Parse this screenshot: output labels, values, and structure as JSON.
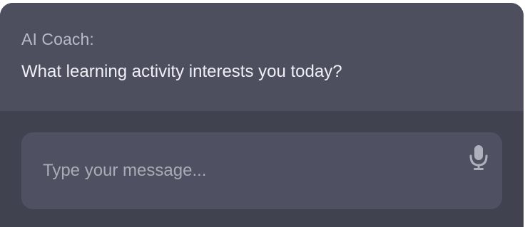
{
  "chat": {
    "sender_label": "AI Coach:",
    "message": "What learning activity interests you today?"
  },
  "composer": {
    "input_value": "",
    "placeholder": "Type your message...",
    "mic_icon": "microphone-icon"
  },
  "colors": {
    "message_panel_bg": "#4d4f5f",
    "window_bg": "#414250",
    "composer_bg": "#4f5162",
    "icon": "#aeb0bb"
  }
}
